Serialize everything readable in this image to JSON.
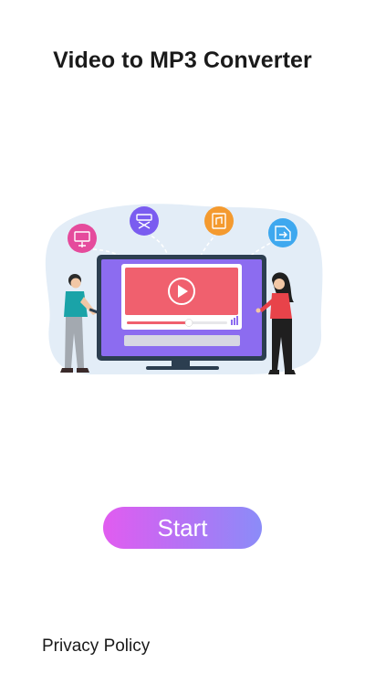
{
  "app": {
    "title": "Video to MP3 Converter"
  },
  "illustration": {
    "icons": [
      "video-to-audio-icon",
      "trim-video-icon",
      "audio-file-icon",
      "export-file-icon"
    ],
    "colors": {
      "background_blob": "#e3edf7",
      "monitor_frame": "#2c3e50",
      "monitor_screen": "#8c6cf0",
      "video_panel": "#f0606e",
      "icon_pink": "#e54b9c",
      "icon_purple": "#7a5cf0",
      "icon_orange": "#f49a2f",
      "icon_blue": "#3ea8ef"
    }
  },
  "buttons": {
    "start_label": "Start"
  },
  "footer": {
    "privacy_label": "Privacy Policy"
  },
  "theme": {
    "gradient_start": "#e15cf0",
    "gradient_end": "#8b8cf8"
  }
}
